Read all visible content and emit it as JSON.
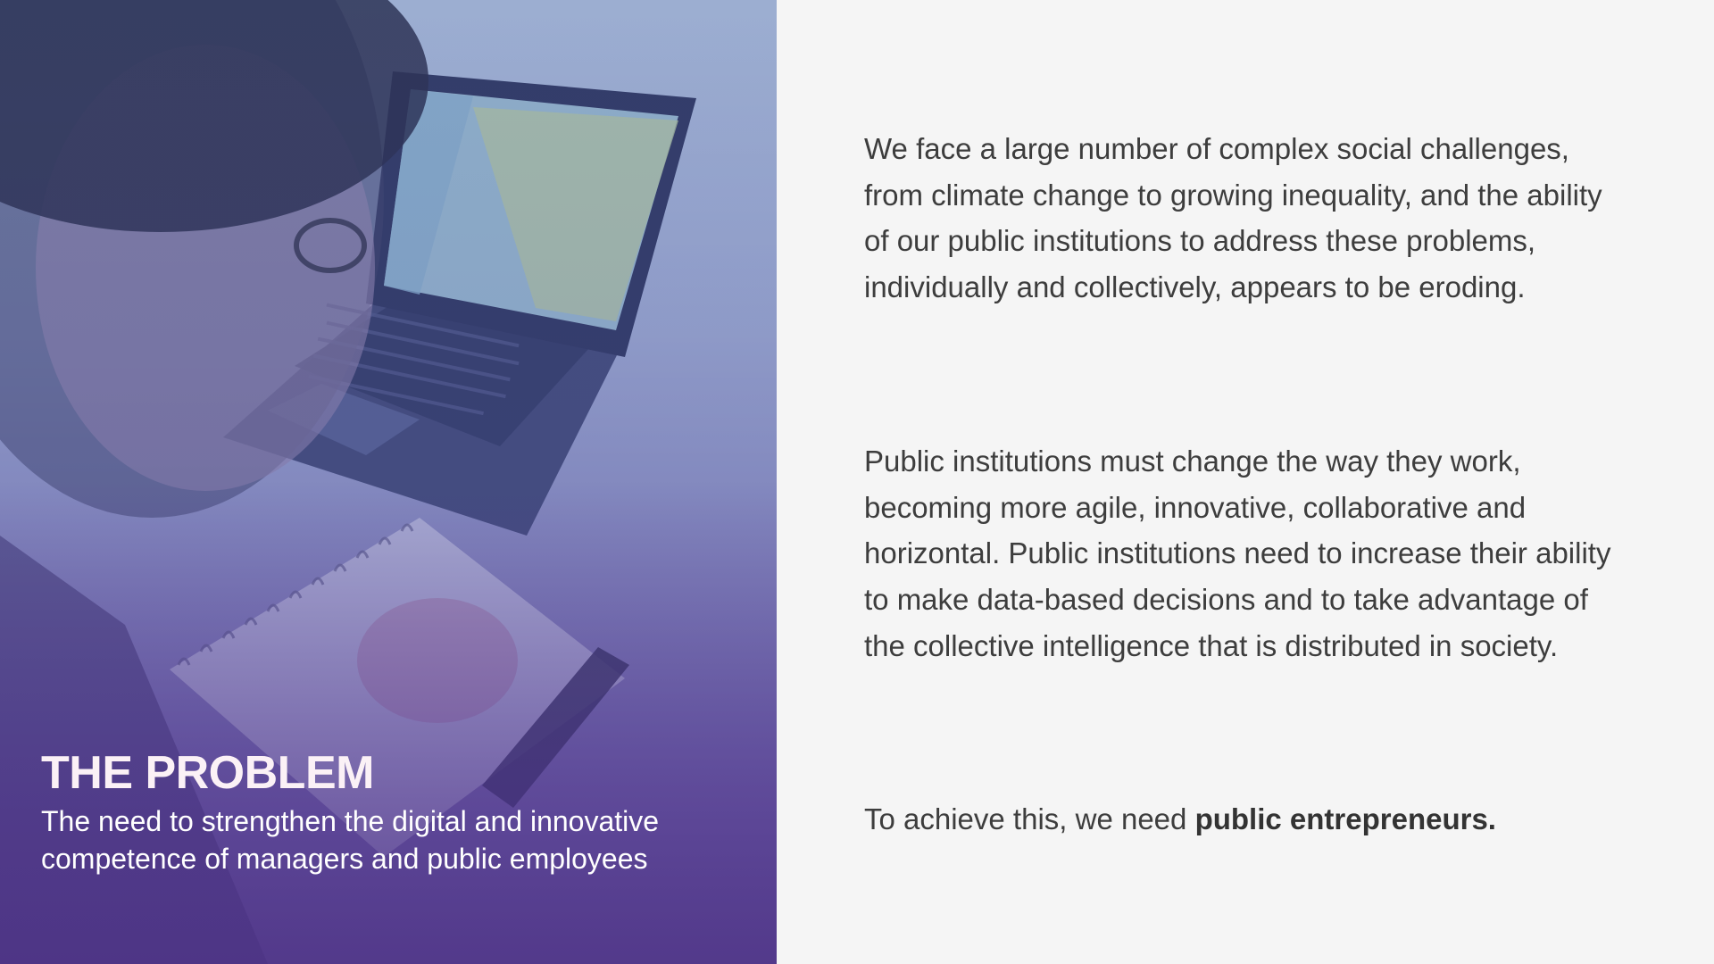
{
  "slide": {
    "image_alt": "person-writing-notes-at-laptop",
    "title": "THE PROBLEM",
    "subtitle": "The need to strengthen the digital and innovative competence of managers and public employees"
  },
  "body": {
    "paragraph_1": "We face a large number of complex social challenges, from climate change to growing inequality, and the ability of our public institutions to address these problems, individually and collectively, appears to be eroding.",
    "paragraph_2": "Public institutions must change the way they work, becoming more agile, innovative, collaborative and horizontal.  Public institutions need to increase their ability to make data-based decisions and to take advantage of the collective intelligence that is distributed in society.",
    "paragraph_3_prefix": "To achieve this, we need ",
    "paragraph_3_bold": "public entrepreneurs."
  },
  "colors": {
    "panel_gradient_top": "#9cb0d0",
    "panel_gradient_bottom": "#4d3584",
    "right_background": "#f5f5f5",
    "body_text": "#3d3d3d"
  }
}
